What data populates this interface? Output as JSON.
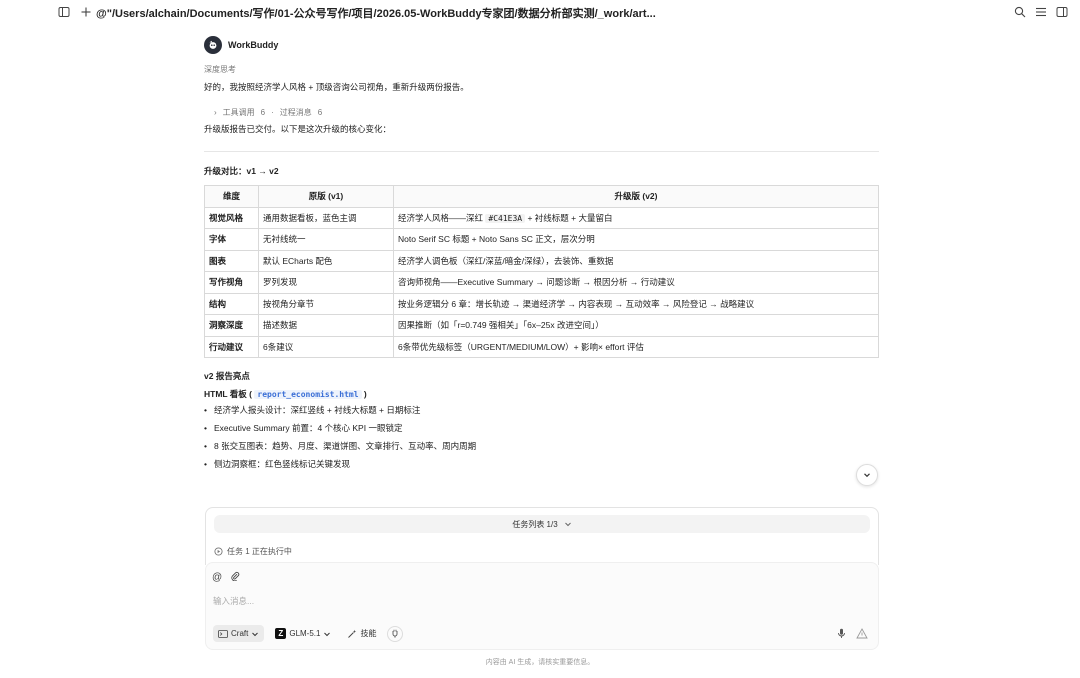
{
  "header": {
    "path": "@\"/Users/alchain/Documents/写作/01-公众号写作/项目/2026.05-WorkBuddy专家团/数据分析部实测/_work/art..."
  },
  "message": {
    "author": "WorkBuddy",
    "thinking_label": "深度思考",
    "intro": "好的，我按照经济学人风格 + 顶级咨询公司视角，重新升级两份报告。",
    "tool_calls_label": "工具调用",
    "tool_calls_count": "6",
    "process_label": "过程消息",
    "process_count": "6",
    "delivered": "升级版报告已交付。以下是这次升级的核心变化：",
    "compare_title": "升级对比：v1 → v2",
    "table": {
      "headers": [
        "维度",
        "原版 (v1)",
        "升级版 (v2)"
      ],
      "rows": [
        {
          "dim": "视觉风格",
          "v1": "通用数据看板，蓝色主调",
          "v2_pre": "经济学人风格——深红 ",
          "v2_code": "#C41E3A",
          "v2_post": " + 衬线标题 + 大量留白"
        },
        {
          "dim": "字体",
          "v1": "无衬线统一",
          "v2": "Noto Serif SC 标题 + Noto Sans SC 正文，层次分明"
        },
        {
          "dim": "图表",
          "v1": "默认 ECharts 配色",
          "v2": "经济学人调色板（深红/深蓝/暗金/深绿），去装饰、重数据"
        },
        {
          "dim": "写作视角",
          "v1": "罗列发现",
          "v2": "咨询师视角——Executive Summary → 问题诊断 → 根因分析 → 行动建议"
        },
        {
          "dim": "结构",
          "v1": "按视角分章节",
          "v2": "按业务逻辑分 6 章：增长轨迹 → 渠道经济学 → 内容表现 → 互动效率 → 风险登记 → 战略建议"
        },
        {
          "dim": "洞察深度",
          "v1": "描述数据",
          "v2": "因果推断（如「r=0.749 强相关」「6x–25x 改进空间」）"
        },
        {
          "dim": "行动建议",
          "v1": "6条建议",
          "v2": "6条带优先级标签（URGENT/MEDIUM/LOW）+ 影响× effort 评估"
        }
      ]
    },
    "highlights_title": "v2 报告亮点",
    "html_board_label": "HTML 看板 (",
    "html_board_file": "report_economist.html",
    "html_board_close": ")",
    "bullets": [
      "经济学人报头设计：深红竖线 + 衬线大标题 + 日期标注",
      "Executive Summary 前置：4 个核心 KPI 一眼锁定",
      "8 张交互图表：趋势、月度、渠道饼图、文章排行、互动率、周内周期",
      "侧边洞察框：红色竖线标记关键发现"
    ]
  },
  "tasks": {
    "header": "任务列表 1/3",
    "status": "任务 1 正在执行中"
  },
  "composer": {
    "placeholder": "输入消息...",
    "mode": "Craft",
    "model": "GLM-5.1",
    "skills": "技能"
  },
  "footer": "内容由 AI 生成，请核实重要信息。",
  "colors": {
    "accent_link": "#3b6fd6",
    "border": "#d9d9d9"
  }
}
